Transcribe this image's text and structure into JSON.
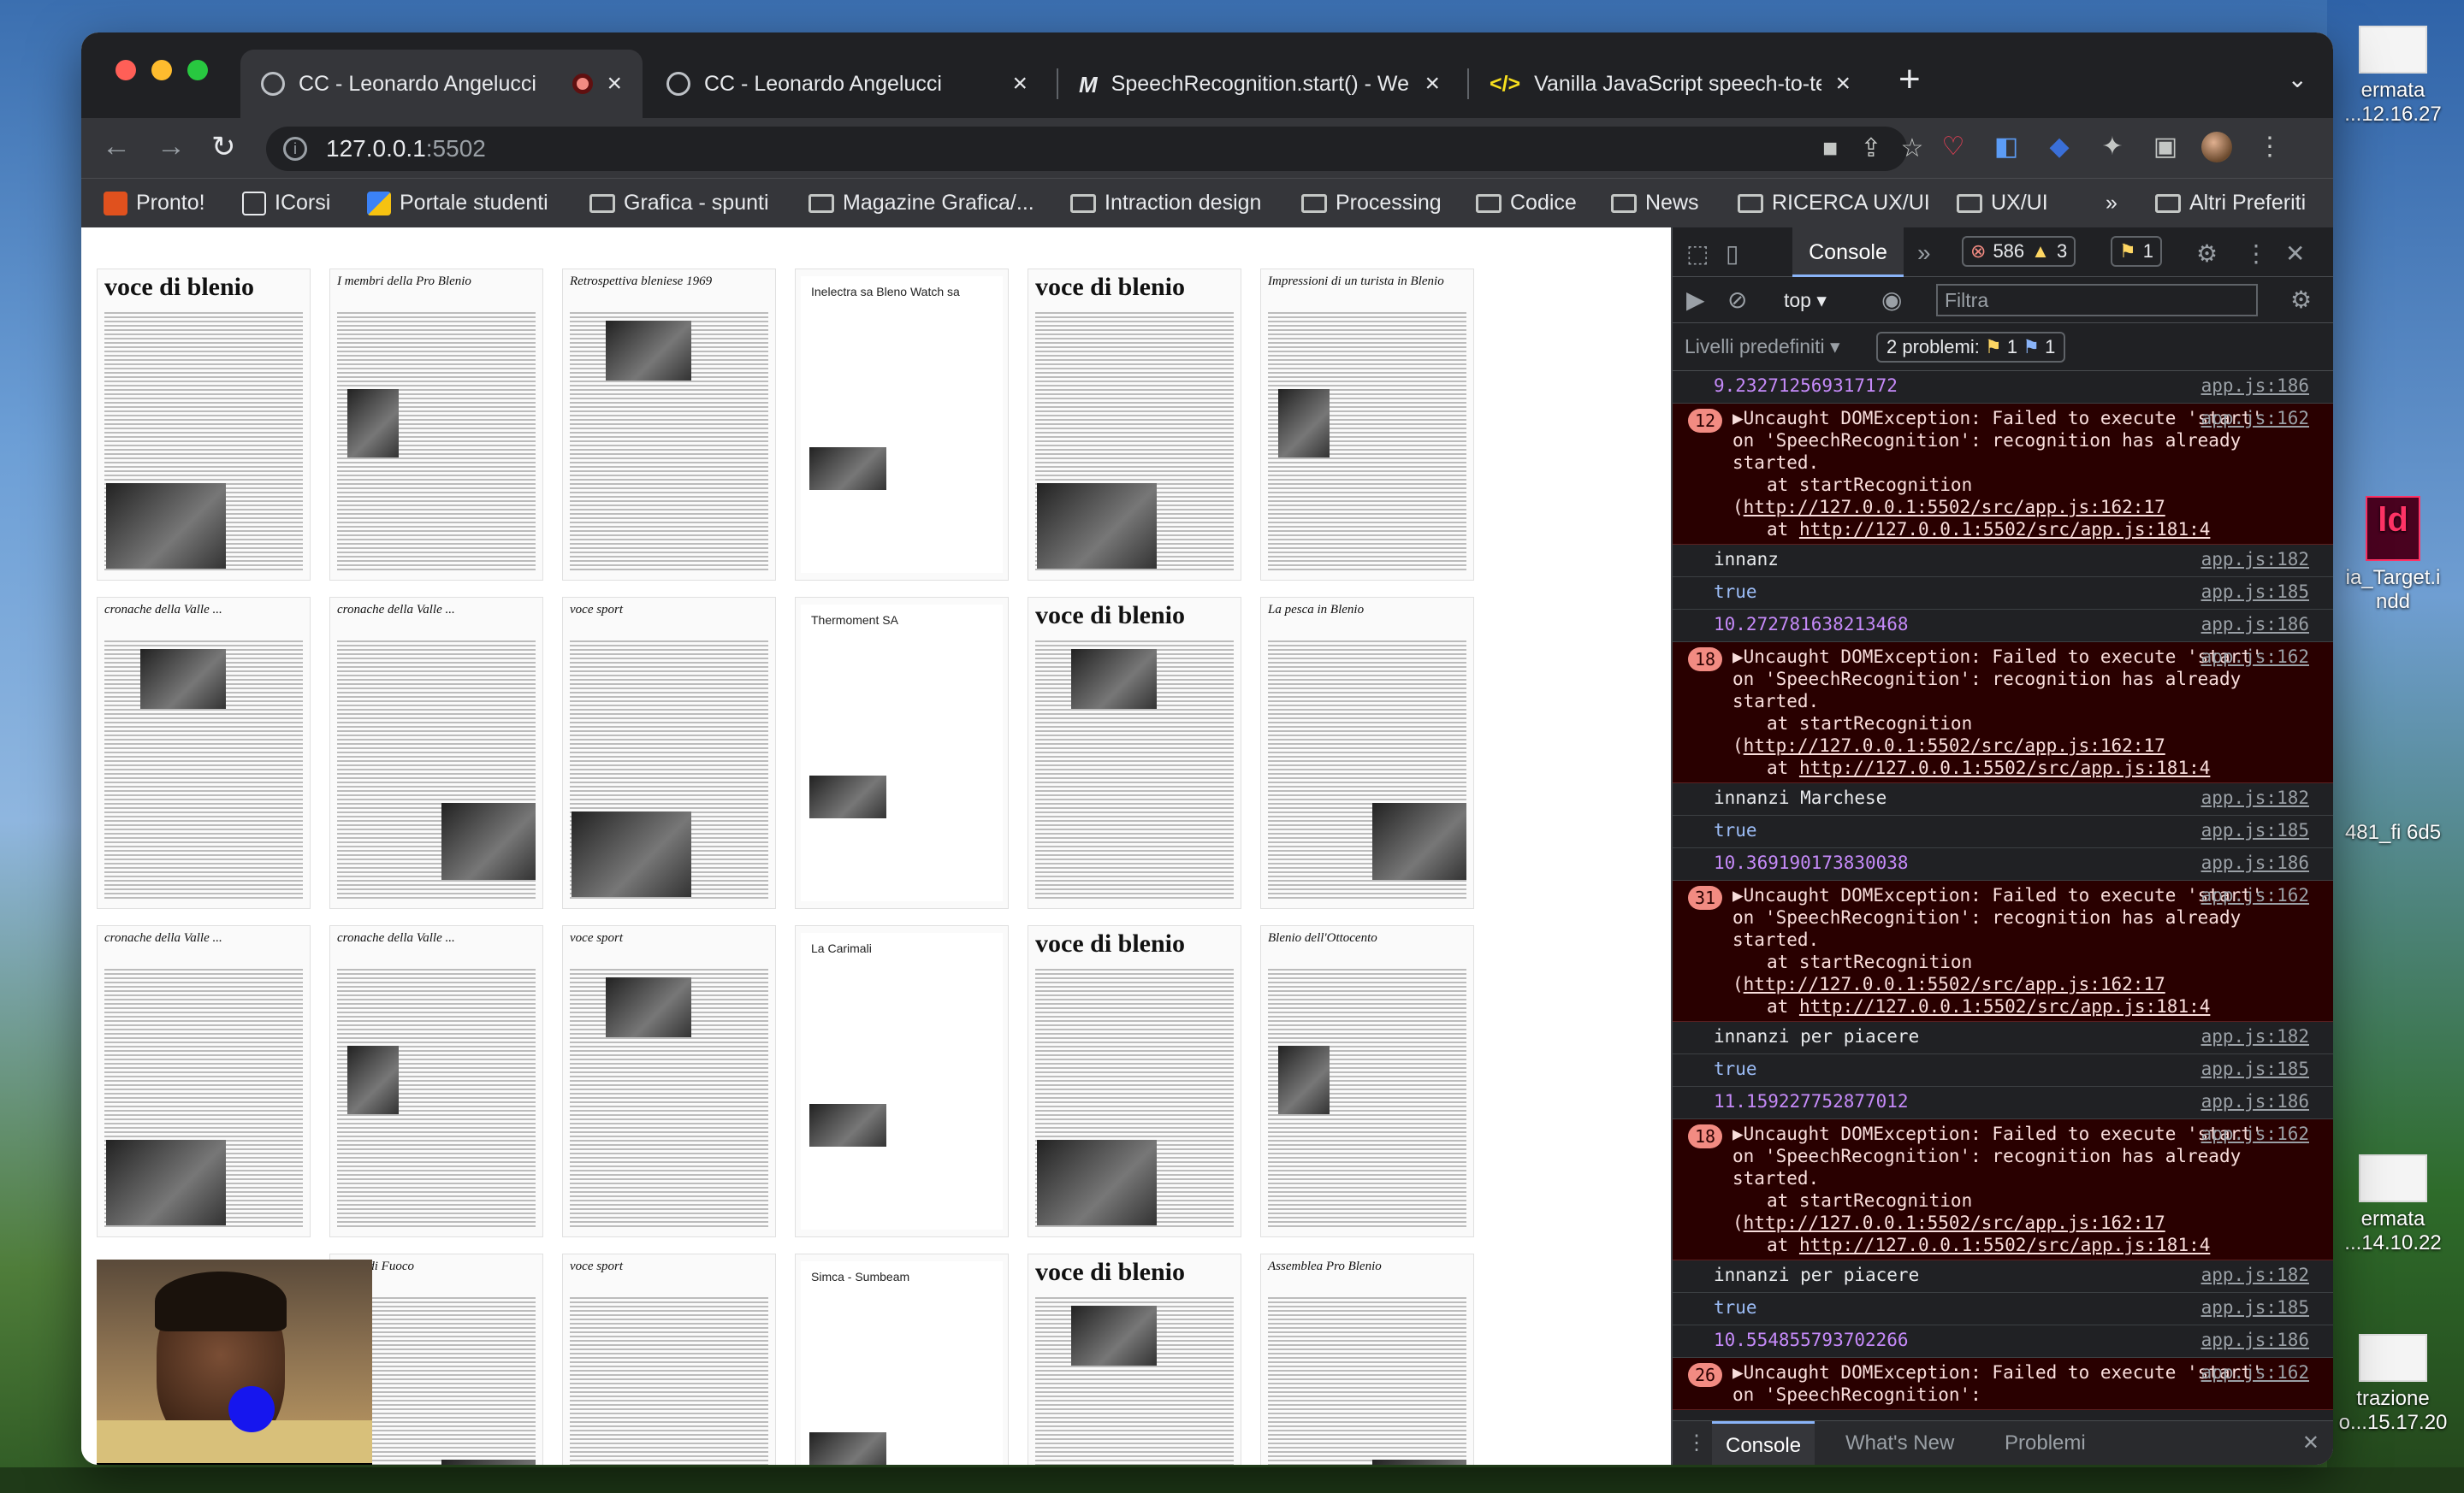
{
  "browser": {
    "tabs": [
      {
        "title": "CC - Leonardo Angelucci",
        "favicon": "globe-icon",
        "recording": true
      },
      {
        "title": "CC - Leonardo Angelucci",
        "favicon": "globe-icon"
      },
      {
        "title": "SpeechRecognition.start() - We",
        "favicon": "mdn-icon"
      },
      {
        "title": "Vanilla JavaScript speech-to-te",
        "favicon": "code-icon"
      }
    ],
    "url_host": "127.0.0.1",
    "url_port": ":5502",
    "bookmarks": [
      "Pronto!",
      "ICorsi",
      "Portale studenti",
      "Grafica - spunti",
      "Magazine Grafica/...",
      "Intraction design",
      "Processing",
      "Codice",
      "News",
      "RICERCA UX/UI",
      "UX/UI"
    ],
    "bookmarks_more": "»",
    "bookmarks_other": "Altri Preferiti"
  },
  "thumbnails": [
    {
      "header": "voce di blenio",
      "big": true
    },
    {
      "header": "I membri della Pro Blenio",
      "big": false
    },
    {
      "header": "Retrospettiva bleniese 1969",
      "big": false
    },
    {
      "header": "Inelectra sa   Bleno Watch sa",
      "big": false,
      "ad": true
    },
    {
      "header": "voce di blenio",
      "big": true
    },
    {
      "header": "Impressioni di un turista in Blenio",
      "big": false
    },
    {
      "header": "cronache della Valle ...",
      "big": false
    },
    {
      "header": "cronache della Valle ...",
      "big": false
    },
    {
      "header": "voce sport",
      "big": false
    },
    {
      "header": "Thermoment SA",
      "big": false,
      "ad": true
    },
    {
      "header": "voce di blenio",
      "big": true
    },
    {
      "header": "La pesca in Blenio",
      "big": false
    },
    {
      "header": "cronache della Valle ...",
      "big": false
    },
    {
      "header": "cronache della Valle ...",
      "big": false
    },
    {
      "header": "voce sport",
      "big": false
    },
    {
      "header": "La Carimali",
      "big": false,
      "ad": true
    },
    {
      "header": "voce di blenio",
      "big": true
    },
    {
      "header": "Blenio dell'Ottocento",
      "big": false
    },
    {
      "header": "",
      "big": false
    },
    {
      "header": "Notte di Fuoco",
      "big": false
    },
    {
      "header": "voce sport",
      "big": false
    },
    {
      "header": "Simca - Sumbeam",
      "big": false,
      "ad": true
    },
    {
      "header": "voce di blenio",
      "big": true
    },
    {
      "header": "Assemblea Pro Blenio",
      "big": false
    }
  ],
  "webcam": {
    "button": "next"
  },
  "devtools": {
    "tab": "Console",
    "errors": "586",
    "warnings": "3",
    "issues": "1",
    "context": "top",
    "filter_placeholder": "Filtra",
    "levels": "Livelli predefiniti",
    "problems": "2 problemi:",
    "problems_w": "1",
    "problems_i": "1",
    "log": [
      {
        "type": "num",
        "text": "9.232712569317172",
        "src": "app.js:186"
      },
      {
        "type": "err",
        "count": "12",
        "text": "▶Uncaught DOMException: Failed to execute 'start' on 'SpeechRecognition': recognition has already started.",
        "at1": "at startRecognition (",
        "link1": "http://127.0.0.1:5502/src/app.js:162:17",
        "at2": "at ",
        "link2": "http://127.0.0.1:5502/src/app.js:181:4",
        "src": "app.js:162"
      },
      {
        "type": "log",
        "text": "innanz",
        "src": "app.js:182"
      },
      {
        "type": "bool",
        "text": "true",
        "src": "app.js:185"
      },
      {
        "type": "num",
        "text": "10.272781638213468",
        "src": "app.js:186"
      },
      {
        "type": "err",
        "count": "18",
        "text": "▶Uncaught DOMException: Failed to execute 'start' on 'SpeechRecognition': recognition has already started.",
        "at1": "at startRecognition (",
        "link1": "http://127.0.0.1:5502/src/app.js:162:17",
        "at2": "at ",
        "link2": "http://127.0.0.1:5502/src/app.js:181:4",
        "src": "app.js:162"
      },
      {
        "type": "log",
        "text": "innanzi Marchese",
        "src": "app.js:182"
      },
      {
        "type": "bool",
        "text": "true",
        "src": "app.js:185"
      },
      {
        "type": "num",
        "text": "10.369190173830038",
        "src": "app.js:186"
      },
      {
        "type": "err",
        "count": "31",
        "text": "▶Uncaught DOMException: Failed to execute 'start' on 'SpeechRecognition': recognition has already started.",
        "at1": "at startRecognition (",
        "link1": "http://127.0.0.1:5502/src/app.js:162:17",
        "at2": "at ",
        "link2": "http://127.0.0.1:5502/src/app.js:181:4",
        "src": "app.js:162"
      },
      {
        "type": "log",
        "text": "innanzi per piacere",
        "src": "app.js:182"
      },
      {
        "type": "bool",
        "text": "true",
        "src": "app.js:185"
      },
      {
        "type": "num",
        "text": "11.159227752877012",
        "src": "app.js:186"
      },
      {
        "type": "err",
        "count": "18",
        "text": "▶Uncaught DOMException: Failed to execute 'start' on 'SpeechRecognition': recognition has already started.",
        "at1": "at startRecognition (",
        "link1": "http://127.0.0.1:5502/src/app.js:162:17",
        "at2": "at ",
        "link2": "http://127.0.0.1:5502/src/app.js:181:4",
        "src": "app.js:162"
      },
      {
        "type": "log",
        "text": "innanzi per piacere",
        "src": "app.js:182"
      },
      {
        "type": "bool",
        "text": "true",
        "src": "app.js:185"
      },
      {
        "type": "num",
        "text": "10.554855793702266",
        "src": "app.js:186"
      },
      {
        "type": "err",
        "count": "26",
        "text": "▶Uncaught DOMException: Failed to execute 'start' on 'SpeechRecognition':",
        "at1": "",
        "link1": "",
        "at2": "",
        "link2": "",
        "src": "app.js:162"
      }
    ],
    "drawer_tabs": [
      "Console",
      "What's New",
      "Problemi"
    ]
  },
  "desktop": {
    "items": [
      "ermata ...12.16.27",
      "ld",
      "ia_Target.i ndd",
      "481_fi 6d5",
      "ermata ...14.10.22",
      "trazione o...15.17.20"
    ]
  }
}
